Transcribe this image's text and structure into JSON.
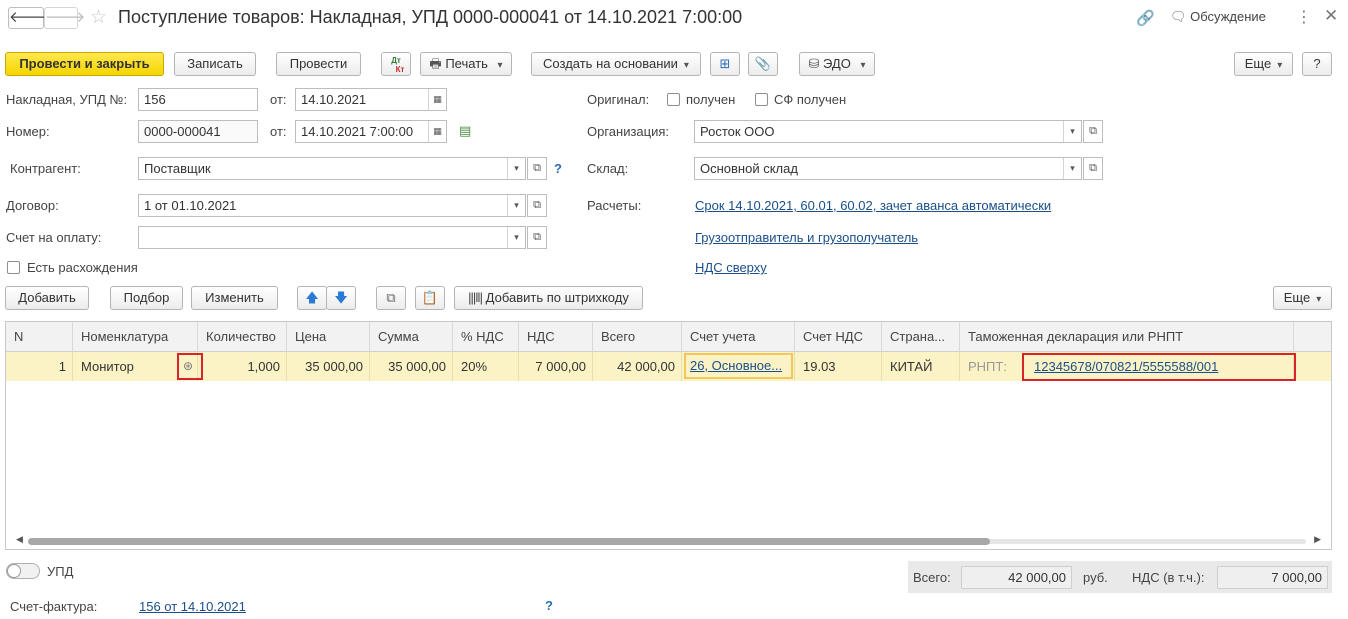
{
  "window": {
    "title": "Поступление товаров: Накладная, УПД 0000-000041 от 14.10.2021 7:00:00",
    "discussion": "Обсуждение"
  },
  "toolbar": {
    "post_close": "Провести и закрыть",
    "save": "Записать",
    "post": "Провести",
    "dtkt_top": "Дт",
    "dtkt_bottom": "Кт",
    "print": "Печать",
    "create_based": "Создать на основании",
    "edo": "ЭДО",
    "more": "Еще",
    "help": "?"
  },
  "form": {
    "invoice_label": "Накладная, УПД №:",
    "invoice_no": "156",
    "from_label": "от:",
    "invoice_date": "14.10.2021",
    "number_label": "Номер:",
    "number": "0000-000041",
    "number_date": "14.10.2021  7:00:00",
    "original_label": "Оригинал:",
    "received": "получен",
    "sf_received": "СФ получен",
    "org_label": "Организация:",
    "org": "Росток ООО",
    "counterparty_label": "Контрагент:",
    "counterparty": "Поставщик",
    "question": "?",
    "warehouse_label": "Склад:",
    "warehouse": "Основной склад",
    "contract_label": "Договор:",
    "contract": "1 от 01.10.2021",
    "settlements_label": "Расчеты:",
    "settlements_link": "Срок 14.10.2021, 60.01, 60.02, зачет аванса автоматически",
    "payment_label": "Счет на оплату:",
    "payment": "",
    "shipper_link": "Грузоотправитель и грузополучатель",
    "discrepancy": "Есть расхождения",
    "vat_link": "НДС сверху"
  },
  "table_toolbar": {
    "add": "Добавить",
    "pick": "Подбор",
    "edit": "Изменить",
    "barcode": "Добавить по штрихкоду",
    "more": "Еще"
  },
  "table": {
    "headers": [
      "N",
      "Номенклатура",
      "Количество",
      "Цена",
      "Сумма",
      "% НДС",
      "НДС",
      "Всего",
      "Счет учета",
      "Счет НДС",
      "Страна...",
      "Таможенная декларация или РНПТ"
    ],
    "row": {
      "n": "1",
      "item": "Монитор",
      "qty": "1,000",
      "price": "35 000,00",
      "sum": "35 000,00",
      "vat_rate": "20%",
      "vat": "7 000,00",
      "total": "42 000,00",
      "account": "26, Основное...",
      "vat_account": "19.03",
      "country": "КИТАЙ",
      "rnpt_label": "РНПТ:",
      "rnpt": "12345678/070821/5555588/001"
    }
  },
  "footer": {
    "upd": "УПД",
    "total_label": "Всего:",
    "total": "42 000,00",
    "currency": "руб.",
    "vat_label": "НДС (в т.ч.):",
    "vat": "7 000,00",
    "invoice_label": "Счет-фактура:",
    "invoice_link": "156 от 14.10.2021",
    "question": "?"
  }
}
